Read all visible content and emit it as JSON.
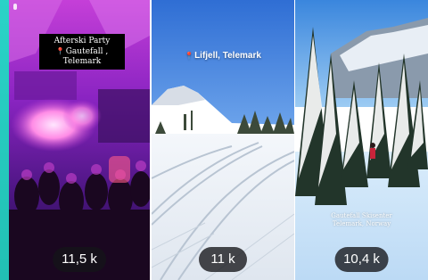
{
  "cards": [
    {
      "title_line": "Afterski Party",
      "location": "Gautefall , Telemark",
      "views": "11,5 k"
    },
    {
      "location": "Lifjell, Telemark",
      "views": "11 k"
    },
    {
      "caption_line1": "Gautefall Skisenter",
      "caption_line2": "Telemark, Norway",
      "views": "10,4 k"
    }
  ],
  "colors": {
    "accent_strip": "#2ad3c7",
    "pin": "#e0313a",
    "party_purple": "#9b2fd1",
    "sky_blue": "#3c78d6"
  },
  "icons": [
    "location-pin-icon",
    "menu-dot-icon"
  ]
}
